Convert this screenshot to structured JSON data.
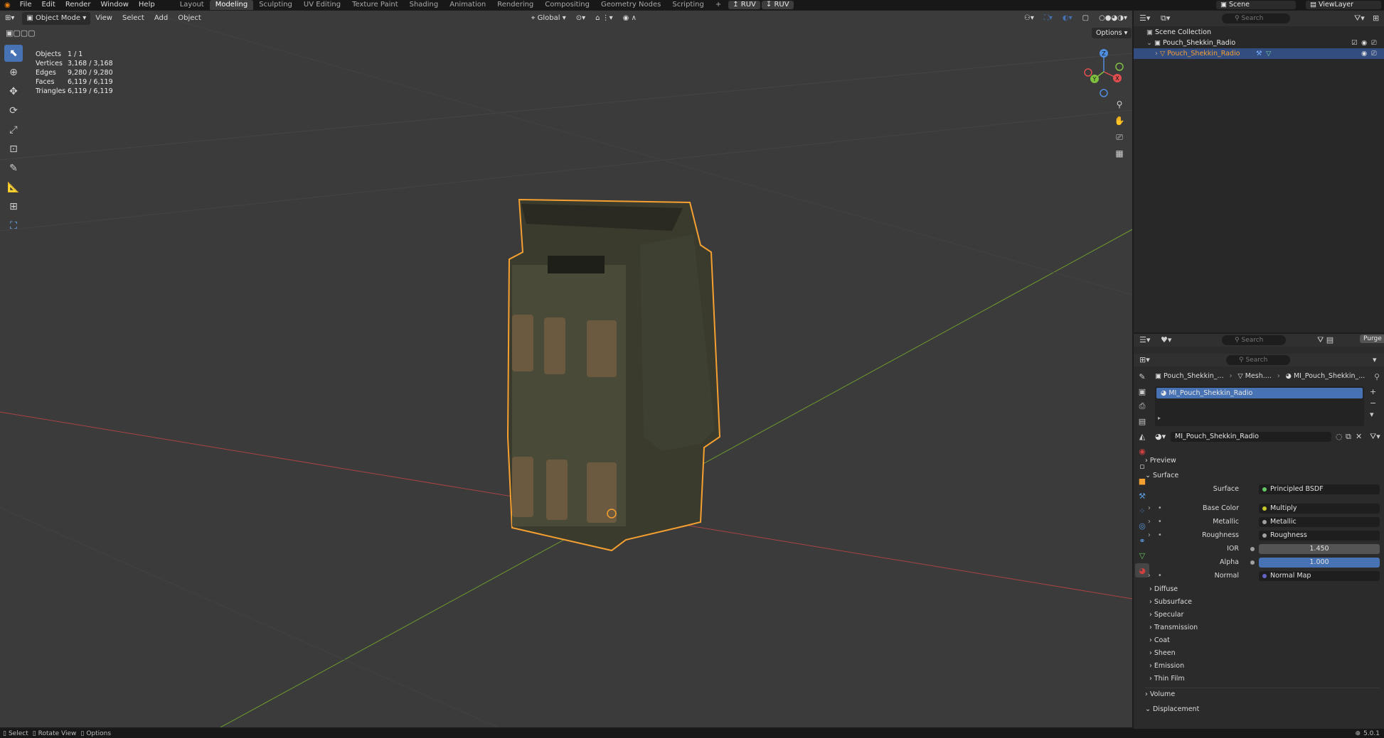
{
  "menus": [
    "File",
    "Edit",
    "Render",
    "Window",
    "Help"
  ],
  "workspaces": [
    "Layout",
    "Modeling",
    "Sculpting",
    "UV Editing",
    "Texture Paint",
    "Shading",
    "Animation",
    "Rendering",
    "Compositing",
    "Geometry Nodes",
    "Scripting"
  ],
  "active_workspace": "Modeling",
  "add_tab": "+",
  "ruv_left": "RUV",
  "ruv_right": "RUV",
  "scene": "Scene",
  "view_layer": "ViewLayer",
  "viewport_header": {
    "mode": "Object Mode",
    "view": "View",
    "select": "Select",
    "add": "Add",
    "object": "Object",
    "orientation": "Global",
    "options": "Options"
  },
  "stats": [
    {
      "label": "Objects",
      "value": "1 / 1"
    },
    {
      "label": "Vertices",
      "value": "3,168 / 3,168"
    },
    {
      "label": "Edges",
      "value": "9,280 / 9,280"
    },
    {
      "label": "Faces",
      "value": "6,119 / 6,119"
    },
    {
      "label": "Triangles",
      "value": "6,119 / 6,119"
    }
  ],
  "gizmo": {
    "z": "Z",
    "y": "Y",
    "x": "X"
  },
  "outliner": {
    "search": "Search",
    "scene_collection": "Scene Collection",
    "collection": "Pouch_Shekkin_Radio",
    "object": "Pouch_Shekkin_Radio"
  },
  "props_header": {
    "search": "Search",
    "purge": "Purge",
    "search2": "Search"
  },
  "breadcrumb": [
    "Pouch_Shekkin_...",
    "Mesh....",
    "MI_Pouch_Shekkin_..."
  ],
  "material_slot": "MI_Pouch_Shekkin_Radio",
  "material_name": "MI_Pouch_Shekkin_Radio",
  "sections": {
    "preview": "Preview",
    "surface": "Surface"
  },
  "surface_props": [
    {
      "label": "Surface",
      "value": "Principled BSDF",
      "dot": "#63c763",
      "kind": "link"
    },
    {
      "label": "Base Color",
      "value": "Multiply",
      "dot": "#c7c729",
      "kind": "link"
    },
    {
      "label": "Metallic",
      "value": "Metallic",
      "dot": "#a1a1a1",
      "kind": "link"
    },
    {
      "label": "Roughness",
      "value": "Roughness",
      "dot": "#a1a1a1",
      "kind": "link"
    },
    {
      "label": "IOR",
      "value": "1.450",
      "dot": "#a1a1a1",
      "kind": "num"
    },
    {
      "label": "Alpha",
      "value": "1.000",
      "dot": "#a1a1a1",
      "kind": "blue"
    },
    {
      "label": "Normal",
      "value": "Normal Map",
      "dot": "#6363c7",
      "kind": "link"
    }
  ],
  "subsections": [
    "Diffuse",
    "Subsurface",
    "Specular",
    "Transmission",
    "Coat",
    "Sheen",
    "Emission",
    "Thin Film"
  ],
  "bottom_sections": [
    "Volume",
    "Displacement"
  ],
  "status": {
    "select": "Select",
    "rotate": "Rotate View",
    "options": "Options",
    "version": "5.0.1"
  },
  "colors": {
    "accent": "#4772b3",
    "selection": "#f5a030",
    "x_axis": "#c44d4d",
    "y_axis": "#6f9a2e"
  }
}
